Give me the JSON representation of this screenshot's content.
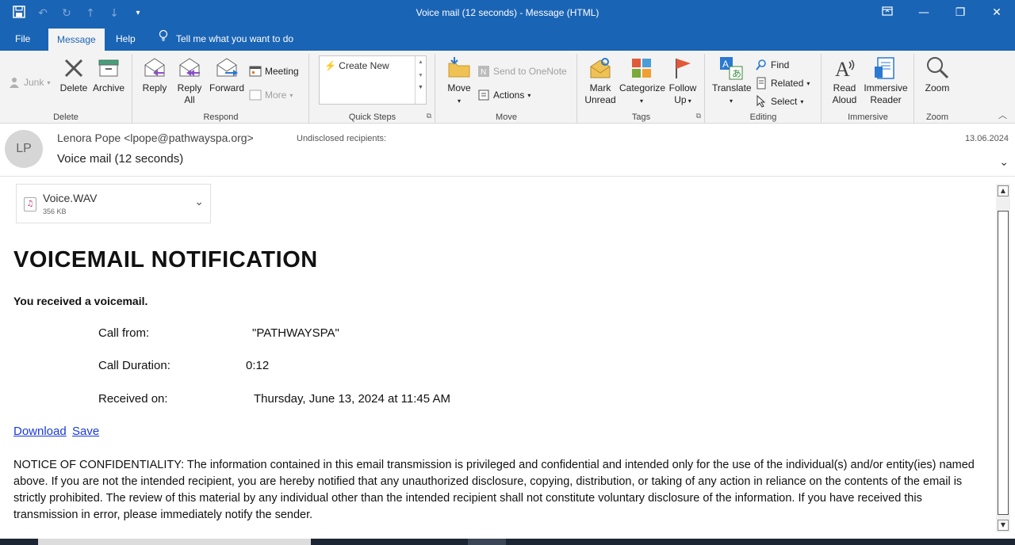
{
  "window": {
    "title": "Voice mail (12 seconds)  -  Message (HTML)"
  },
  "tabs": {
    "file": "File",
    "message": "Message",
    "help": "Help",
    "tell_me": "Tell me what you want to do"
  },
  "ribbon": {
    "delete_group": {
      "label": "Delete",
      "junk": "Junk",
      "delete": "Delete",
      "archive": "Archive"
    },
    "respond_group": {
      "label": "Respond",
      "reply": "Reply",
      "reply_all_1": "Reply",
      "reply_all_2": "All",
      "forward": "Forward",
      "meeting": "Meeting",
      "more": "More"
    },
    "quick_steps_group": {
      "label": "Quick Steps",
      "create_new": "Create New"
    },
    "move_group": {
      "label": "Move",
      "move": "Move",
      "send_to_onenote": "Send to OneNote",
      "actions": "Actions"
    },
    "tags_group": {
      "label": "Tags",
      "mark_unread_1": "Mark",
      "mark_unread_2": "Unread",
      "categorize": "Categorize",
      "follow_up_1": "Follow",
      "follow_up_2": "Up"
    },
    "editing_group": {
      "label": "Editing",
      "translate": "Translate",
      "find": "Find",
      "related": "Related",
      "select": "Select"
    },
    "immersive_group": {
      "label": "Immersive",
      "read_aloud_1": "Read",
      "read_aloud_2": "Aloud",
      "immersive_reader_1": "Immersive",
      "immersive_reader_2": "Reader"
    },
    "zoom_group": {
      "label": "Zoom",
      "zoom": "Zoom"
    }
  },
  "header": {
    "avatar_initials": "LP",
    "from": "Lenora Pope <lpope@pathwayspa.org>",
    "to": "Undisclosed recipients:",
    "subject": "Voice mail (12 seconds)",
    "date": "13.06.2024"
  },
  "attachment": {
    "name": "Voice.WAV",
    "size": "356 KB"
  },
  "body": {
    "heading": "VOICEMAIL NOTIFICATION",
    "intro": "You received a voicemail.",
    "call_from_label": "Call from:",
    "call_from_value": "\"PATHWAYSPA\"",
    "duration_label": "Call Duration:",
    "duration_value": "0:12",
    "received_label": "Received on:",
    "received_value": "Thursday, June 13, 2024 at 11:45 AM",
    "download_link": "Download",
    "save_link": "Save",
    "notice": "NOTICE OF CONFIDENTIALITY: The information contained in this email transmission is privileged and confidential and intended only for the use of the individual(s) and/or entity(ies) named above. If you are not the intended recipient, you are hereby notified that any unauthorized disclosure, copying, distribution, or taking of any action in reliance on the contents of the email is strictly prohibited. The review of this material by any individual other than the intended recipient shall not constitute voluntary disclosure of the information. If you have received this transmission in error, please immediately notify the sender."
  },
  "colors": {
    "title_bar": "#1a64b5",
    "ribbon_bg": "#f3f3f3",
    "link": "#1a3ad6"
  }
}
